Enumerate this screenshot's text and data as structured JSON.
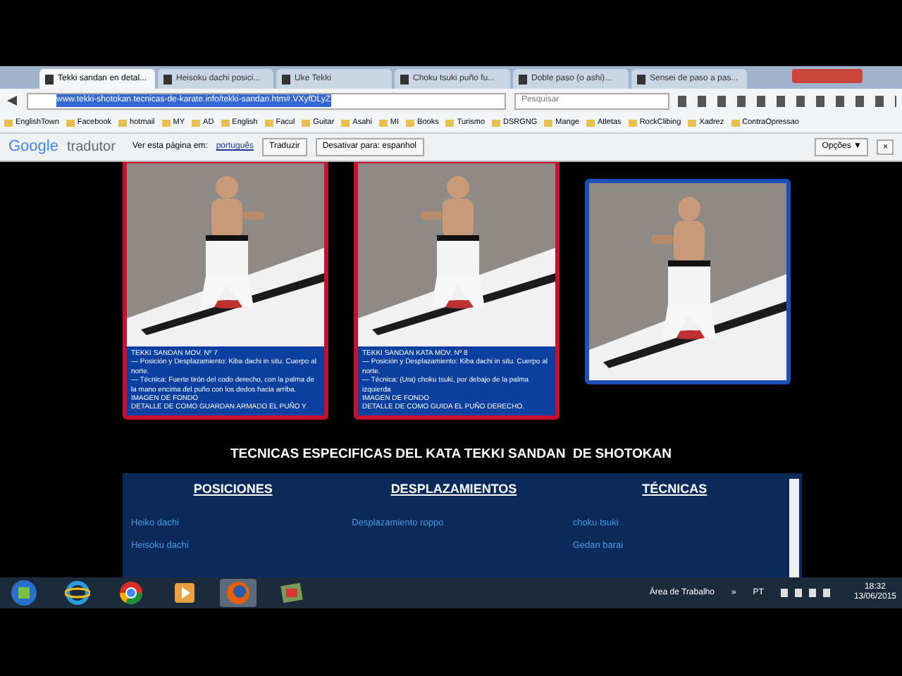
{
  "tabs": [
    {
      "label": "Tekki sandan en detal...",
      "selected": true
    },
    {
      "label": "Heisoku dachi posici...",
      "selected": false
    },
    {
      "label": "Uke Tekki",
      "selected": false
    },
    {
      "label": "Choku tsuki puño fu...",
      "selected": false
    },
    {
      "label": "Doble paso (o ashi)...",
      "selected": false
    },
    {
      "label": "Sensei de paso a pas...",
      "selected": false
    }
  ],
  "address": {
    "url": "www.tekki-shotokan.tecnicas-de-karate.info/tekki-sandan.htm#.VXyfDLyZ",
    "search_placeholder": "Pesquisar"
  },
  "bookmarks": [
    "EnglishTown",
    "Facebook",
    "hotmail",
    "MY",
    "AD",
    "English",
    "Facul",
    "Guitar",
    "Asahi",
    "MI",
    "Books",
    "Turismo",
    "DSRGNG",
    "Mange",
    "Atletas",
    "RockClibing",
    "Xadrez",
    "ContraOpressao"
  ],
  "translate_bar": {
    "brand_google": "Google",
    "brand_tradutor": "tradutor",
    "prompt": "Ver esta página em:",
    "language": "português",
    "translate_button": "Traduzir",
    "disable_button": "Desativar para: espanhol",
    "options_button": "Opções ▼",
    "close": "×"
  },
  "cards": [
    {
      "color": "#c8102e",
      "text": [
        "TEKKI SANDAN MOV. Nº 7",
        "— Posición y Desplazamiento: Kiba dachi in situ. Cuerpo al norte.",
        "— Técnica: Fuerte tirón del codo derecho, con la palma de la mano encima del puño con los dedos hacia arriba.",
        "IMAGEN DE FONDO",
        "DETALLE DE COMO GUARDAN ARMADO EL PUÑO Y"
      ]
    },
    {
      "color": "#c8102e",
      "text": [
        "TEKKI SANDAN KATA MOV. Nº 8",
        "— Posición y Desplazamiento: Kiba dachi in situ. Cuerpo al norte.",
        "— Técnica: (Ura) choku tsuki, por debajo de la palma izquierda",
        "IMAGEN DE FONDO",
        "DETALLE DE COMO GUIDA EL PUÑO DERECHO."
      ]
    },
    {
      "color": "#1d4fb8"
    }
  ],
  "section": {
    "title": "TECNICAS ESPECIFICAS DEL KATA TEKKI SANDAN  DE SHOTOKAN",
    "columns": [
      {
        "heading": "POSICIONES",
        "items": [
          "Heiko dachi",
          "Heisoku dachi"
        ]
      },
      {
        "heading": "DESPLAZAMIENTOS",
        "items": [
          "Desplazamiento roppo"
        ]
      },
      {
        "heading": "TÉCNICAS",
        "items": [
          "choku tsuki",
          "Gedan barai"
        ]
      }
    ]
  },
  "taskbar": {
    "apps": [
      {
        "kind": "windows",
        "selected": false
      },
      {
        "kind": "ie",
        "selected": false
      },
      {
        "kind": "chrome",
        "selected": false
      },
      {
        "kind": "media",
        "selected": false
      },
      {
        "kind": "firefox",
        "selected": true
      },
      {
        "kind": "other",
        "selected": false
      }
    ],
    "tray_label": "Área de Trabalho",
    "chevron": "»",
    "language": "PT",
    "time": "18:32",
    "date": "13/06/2015"
  }
}
